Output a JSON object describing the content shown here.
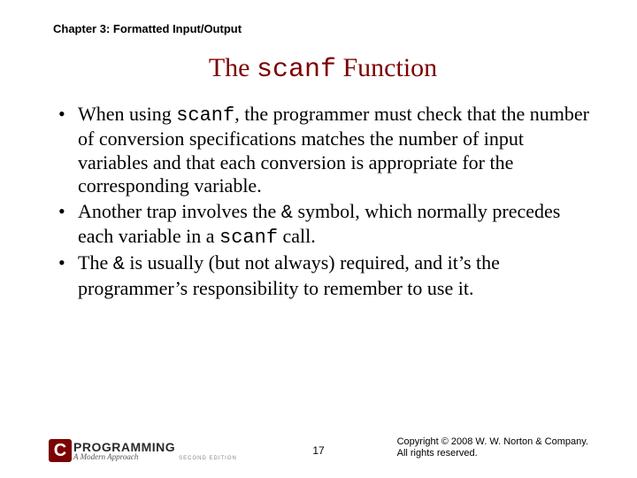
{
  "chapter": "Chapter 3: Formatted Input/Output",
  "title_pre": "The ",
  "title_mono": "scanf",
  "title_post": " Function",
  "b1_a": "When using ",
  "b1_mono": "scanf",
  "b1_b": ", the programmer must check that the number of conversion specifications matches the number of input variables and that each conversion is appropriate for the corresponding variable.",
  "b2_a": "Another trap involves the ",
  "b2_mono": "&",
  "b2_b": " symbol, which normally precedes each variable in a ",
  "b2_mono2": "scanf",
  "b2_c": " call.",
  "b3_a": "The ",
  "b3_mono": "&",
  "b3_b": " is usually (but not always) required, and it’s the programmer’s responsibility to remember to use it.",
  "logo_c": "C",
  "logo_main": "PROGRAMMING",
  "logo_sub": "A Modern Approach",
  "logo_ed": "SECOND EDITION",
  "page": "17",
  "copy1": "Copyright © 2008 W. W. Norton & Company.",
  "copy2": "All rights reserved."
}
